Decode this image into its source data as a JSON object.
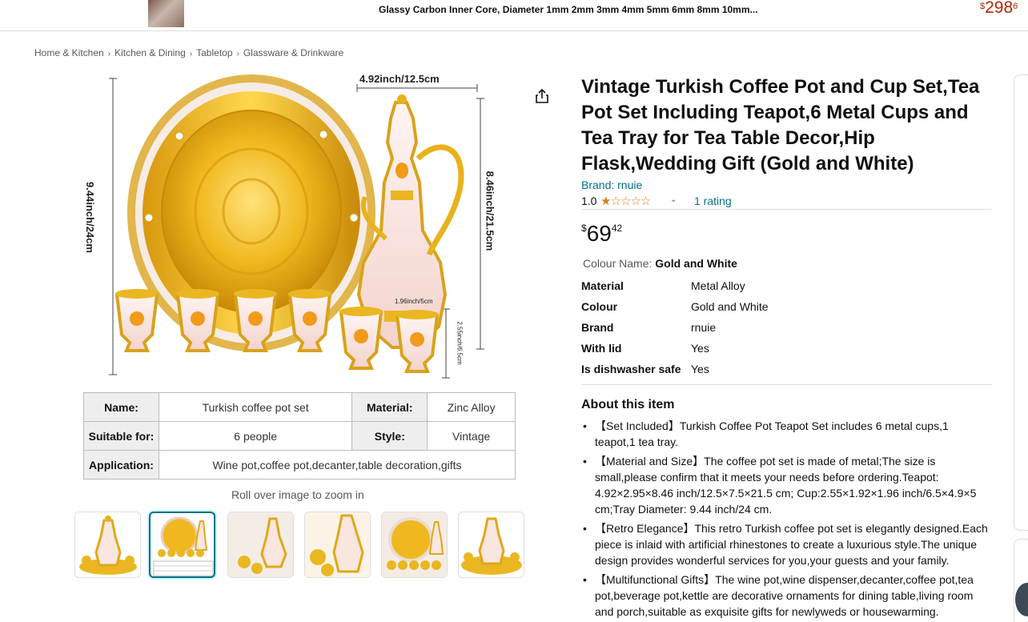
{
  "topbar": {
    "title": "Glassy Carbon Inner Core, Diameter 1mm 2mm 3mm 4mm 5mm 6mm 8mm 10mm...",
    "price_symbol": "$",
    "price_whole": "298",
    "price_fraction": "6"
  },
  "breadcrumb": [
    "Home & Kitchen",
    "Kitchen & Dining",
    "Tabletop",
    "Glassware & Drinkware"
  ],
  "breadcrumb_sep": "›",
  "image": {
    "dim_width": "4.92inch/12.5cm",
    "dim_tray": "9.44inch/24cm",
    "dim_pot_height": "8.46inch/21.5cm",
    "dim_cup_width": "1.96inch/5cm",
    "dim_cup_height": "2.55inch/6.5cm",
    "table": {
      "r1": {
        "k1": "Name:",
        "v1": "Turkish coffee pot set",
        "k2": "Material:",
        "v2": "Zinc Alloy"
      },
      "r2": {
        "k1": "Suitable for:",
        "v1": "6 people",
        "k2": "Style:",
        "v2": "Vintage"
      },
      "r3": {
        "k1": "Application:",
        "v1": "Wine pot,coffee pot,decanter,table decoration,gifts"
      }
    }
  },
  "rollover_text": "Roll over image to zoom in",
  "thumbnails": 6,
  "product": {
    "title": "Vintage Turkish Coffee Pot and Cup Set,Tea Pot Set Including Teapot,6 Metal Cups and Tea Tray for Tea Table Decor,Hip Flask,Wedding Gift (Gold and White)",
    "brand": "Brand: rnuie",
    "rating_value": "1.0",
    "stars": "★☆☆☆☆",
    "rating_count": "1 rating",
    "price_symbol": "$",
    "price_whole": "69",
    "price_fraction": "42",
    "colour_label": "Colour Name: ",
    "colour_value": "Gold and White",
    "attributes": [
      {
        "k": "Material",
        "v": "Metal Alloy"
      },
      {
        "k": "Colour",
        "v": "Gold and White"
      },
      {
        "k": "Brand",
        "v": "rnuie"
      },
      {
        "k": "With lid",
        "v": "Yes"
      },
      {
        "k": "Is dishwasher safe",
        "v": "Yes"
      }
    ],
    "about_heading": "About this item",
    "about": [
      "【Set Included】Turkish Coffee Pot Teapot Set includes 6 metal cups,1 teapot,1 tea tray.",
      "【Material and Size】The coffee pot set is made of metal;The size is small,please confirm that it meets your needs before ordering.Teapot: 4.92×2.95×8.46 inch/12.5×7.5×21.5 cm; Cup:2.55×1.92×1.96 inch/6.5×4.9×5 cm;Tray Diameter: 9.44 inch/24 cm.",
      "【Retro Elegance】This retro Turkish coffee pot set is elegantly designed.Each piece is inlaid with artificial rhinestones to create a luxurious style.The unique design provides wonderful services for you,your guests and your family.",
      "【Multifunctional Gifts】The wine pot,wine dispenser,decanter,coffee pot,tea pot,beverage pot,kettle are decorative ornaments for dining table,living room and porch,suitable as exquisite gifts for newlyweds or housewarming."
    ]
  },
  "colors": {
    "link": "#007185",
    "price_red": "#b12704",
    "star": "#de7921",
    "gold": "#e8b21c"
  }
}
